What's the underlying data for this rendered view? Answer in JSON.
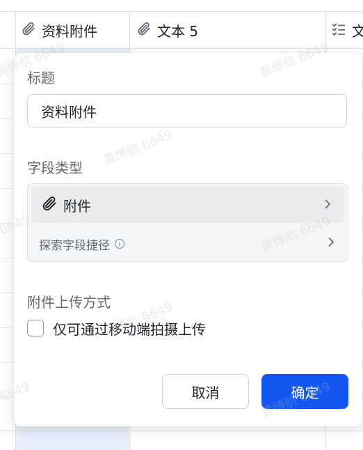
{
  "table": {
    "columns": [
      {
        "label": "资料附件",
        "icon": "paperclip-icon"
      },
      {
        "label": "文本 5",
        "icon": "paperclip-icon"
      },
      {
        "label": "文",
        "icon": "checklist-icon"
      }
    ]
  },
  "watermark": "黄博航 6649",
  "panel": {
    "title_label": "标题",
    "title_value": "资料附件",
    "field_type_label": "字段类型",
    "field_type_value": "附件",
    "field_type_icon": "paperclip-icon",
    "shortcut_label": "探索字段捷径",
    "upload_label": "附件上传方式",
    "mobile_only_label": "仅可通过移动端拍摄上传",
    "mobile_only_checked": false,
    "cancel_label": "取消",
    "ok_label": "确定"
  },
  "colors": {
    "primary": "#1456f0",
    "selected_column": "#e8eefc"
  }
}
